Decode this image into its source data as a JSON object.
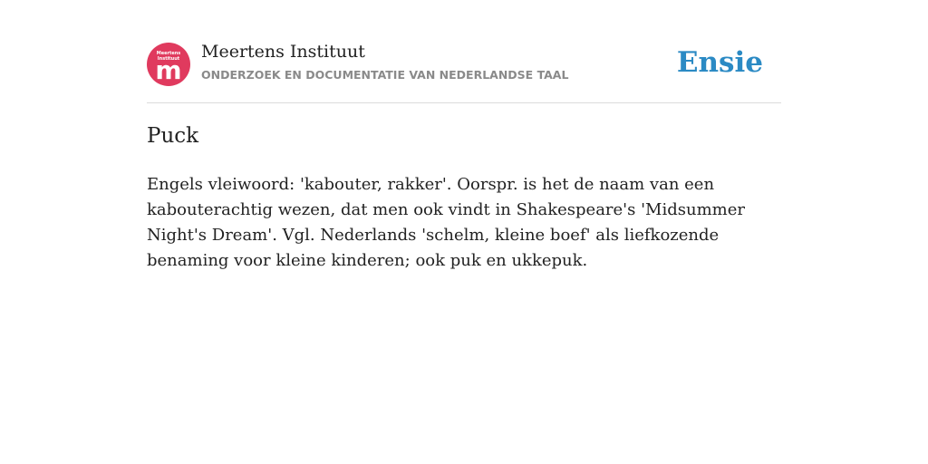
{
  "header": {
    "logo": {
      "line1": "Meertens",
      "line2": "Instituut",
      "letter": "m",
      "color": "#e03a5e"
    },
    "title": "Meertens Instituut",
    "subtitle": "ONDERZOEK EN DOCUMENTATIE VAN NEDERLANDSE TAAL",
    "brand": "Ensie",
    "brand_color": "#2b8ac4"
  },
  "entry": {
    "title": "Puck",
    "body": "Engels vleiwoord: 'kabouter, rakker'. Oorspr. is het de naam van een kabouterachtig wezen, dat men ook vindt in Shakespeare's 'Midsummer Night's Dream'. Vgl. Nederlands 'schelm, kleine boef' als liefkozende benaming voor kleine kinderen; ook puk en ukkepuk."
  }
}
